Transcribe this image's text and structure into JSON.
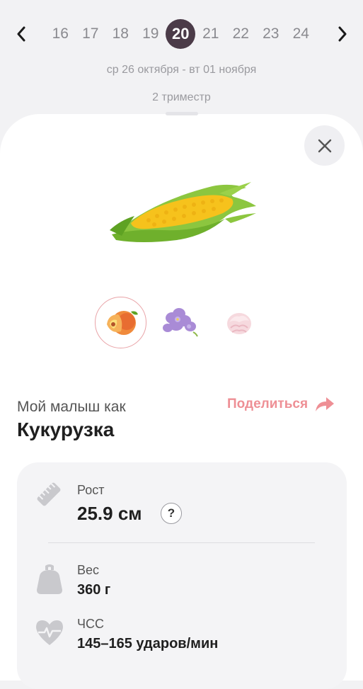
{
  "week_nav": {
    "weeks": [
      "16",
      "17",
      "18",
      "19",
      "20",
      "21",
      "22",
      "23",
      "24"
    ],
    "active_week": "20"
  },
  "date_range": "ср 26 октября - вт 01 ноября",
  "trimester": "2 триместр",
  "comparison": {
    "subtitle": "Мой малыш как",
    "name": "Кукурузка",
    "share_label": "Поделиться",
    "thumbnails": [
      "peach",
      "violet-flower",
      "marshmallow"
    ]
  },
  "metrics": {
    "height": {
      "label": "Рост",
      "value": "25.9 см",
      "help": "?"
    },
    "weight": {
      "label": "Вес",
      "value": "360 г"
    },
    "heart_rate": {
      "label": "ЧСС",
      "value": "145–165 ударов/мин"
    }
  },
  "colors": {
    "accent": "#ee8f95",
    "active_week_bg": "#4b3b48",
    "sheet_bg": "#ffffff",
    "page_bg": "#f2f2f4"
  }
}
